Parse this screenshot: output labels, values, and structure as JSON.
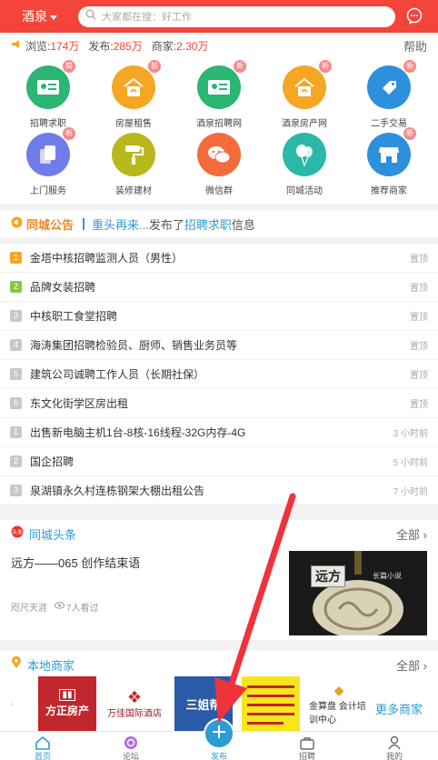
{
  "header": {
    "city": "酒泉",
    "search_placeholder": "大家都在搜：好工作"
  },
  "stats": {
    "views_label": "浏览:",
    "views": "174万",
    "posts_label": "发布:",
    "posts": "285万",
    "merchants_label": "商家:",
    "merchants": "2.30万",
    "help": "帮助"
  },
  "categories": [
    {
      "label": "招聘求职",
      "badge": "简",
      "color": "#2bb673",
      "icon": "id-card-icon"
    },
    {
      "label": "房屋租售",
      "badge": "装",
      "color": "#f5a623",
      "icon": "house-icon"
    },
    {
      "label": "酒泉招聘网",
      "badge": "新",
      "color": "#2bb673",
      "icon": "id-card-icon"
    },
    {
      "label": "酒泉房产网",
      "badge": "新",
      "color": "#f5a623",
      "icon": "house-icon"
    },
    {
      "label": "二手交易",
      "badge": "新",
      "color": "#2e8fdd",
      "icon": "sell-tag-icon"
    },
    {
      "label": "上门服务",
      "badge": "新",
      "color": "#6f7de8",
      "icon": "copy-icon"
    },
    {
      "label": "装修建材",
      "badge": "",
      "color": "#b8b81e",
      "icon": "paint-roller-icon"
    },
    {
      "label": "微信群",
      "badge": "",
      "color": "#f46b3c",
      "icon": "wechat-icon"
    },
    {
      "label": "同城活动",
      "badge": "",
      "color": "#2bb8a8",
      "icon": "balloon-icon"
    },
    {
      "label": "推荐商家",
      "badge": "新",
      "color": "#2e8fdd",
      "icon": "shop-icon"
    }
  ],
  "notice": {
    "title": "同城公告",
    "who": "重头再来...",
    "text1": "发布了",
    "link": "招聘求职",
    "text2": "信息"
  },
  "top_list": [
    {
      "idx": "1",
      "text": "金塔中核招聘监测人员（男性）",
      "meta": "置顶",
      "color": "#f5a623"
    },
    {
      "idx": "2",
      "text": "品牌女装招聘",
      "meta": "置顶",
      "color": "#8cc63f"
    },
    {
      "idx": "3",
      "text": "中核职工食堂招聘",
      "meta": "置顶",
      "color": "#c8c8c8"
    },
    {
      "idx": "4",
      "text": "海涛集团招聘检验员、厨师、销售业务员等",
      "meta": "置顶",
      "color": "#c8c8c8"
    },
    {
      "idx": "5",
      "text": "建筑公司诚聘工作人员（长期社保）",
      "meta": "置顶",
      "color": "#c8c8c8"
    },
    {
      "idx": "6",
      "text": "东文化街学区房出租",
      "meta": "置顶",
      "color": "#c8c8c8"
    },
    {
      "idx": "1",
      "text": "出售新电脑主机1台-8核-16线程-32G内存-4G",
      "meta": "3 小时前",
      "color": "#c8c8c8"
    },
    {
      "idx": "2",
      "text": "国企招聘",
      "meta": "5 小时前",
      "color": "#c8c8c8"
    },
    {
      "idx": "3",
      "text": "泉湖镇永久村连栋钢架大棚出租公告",
      "meta": "7 小时前",
      "color": "#c8c8c8"
    }
  ],
  "headline": {
    "section": "同城头条",
    "more": "全部",
    "title": "远方——065 创作结束语",
    "author": "咫尺天涯",
    "views": "7人看过",
    "thumb_tag": "远方",
    "thumb_sub": "长篇小说"
  },
  "merchants": {
    "section": "本地商家",
    "more": "全部",
    "items": [
      "方正房产",
      "万佳国际酒店",
      "三姐帮",
      "",
      "金算盘 会计培训中心"
    ],
    "more_label": "更多商家"
  },
  "nav": {
    "home": "首页",
    "forum": "论坛",
    "publish": "发布",
    "jobs": "招聘",
    "mine": "我的"
  },
  "colors": {
    "brand": "#f5443a",
    "accent": "#2e9bd6"
  }
}
